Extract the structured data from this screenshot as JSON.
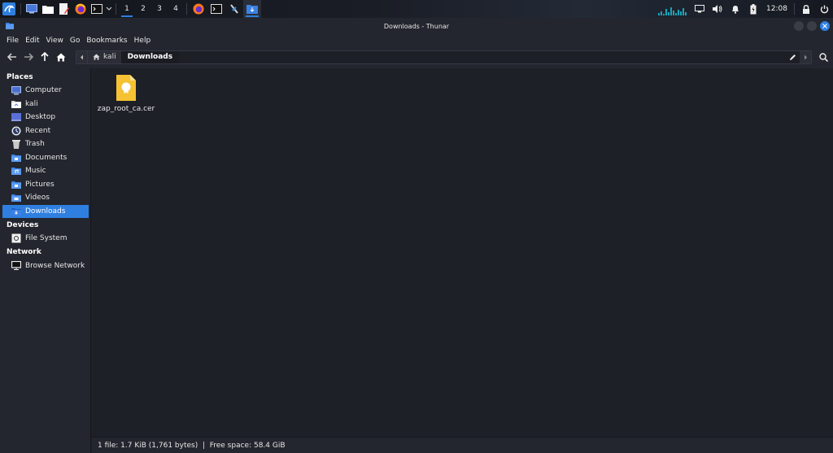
{
  "taskbar": {
    "workspaces": [
      "1",
      "2",
      "3",
      "4"
    ],
    "active_workspace": "1",
    "clock": "12:08",
    "colors": {
      "accent": "#2f7fe0",
      "graph": "#1aa3b8"
    }
  },
  "window": {
    "title": "Downloads - Thunar",
    "menu": [
      "File",
      "Edit",
      "View",
      "Go",
      "Bookmarks",
      "Help"
    ],
    "path": {
      "home": "kali",
      "current": "Downloads"
    }
  },
  "sidebar": {
    "places": {
      "header": "Places",
      "items": [
        {
          "label": "Computer",
          "icon": "computer-icon"
        },
        {
          "label": "kali",
          "icon": "home-folder-icon"
        },
        {
          "label": "Desktop",
          "icon": "desktop-icon"
        },
        {
          "label": "Recent",
          "icon": "recent-icon"
        },
        {
          "label": "Trash",
          "icon": "trash-icon"
        },
        {
          "label": "Documents",
          "icon": "documents-folder-icon"
        },
        {
          "label": "Music",
          "icon": "music-folder-icon"
        },
        {
          "label": "Pictures",
          "icon": "pictures-folder-icon"
        },
        {
          "label": "Videos",
          "icon": "videos-folder-icon"
        },
        {
          "label": "Downloads",
          "icon": "downloads-folder-icon",
          "selected": true
        }
      ]
    },
    "devices": {
      "header": "Devices",
      "items": [
        {
          "label": "File System",
          "icon": "drive-icon"
        }
      ]
    },
    "network": {
      "header": "Network",
      "items": [
        {
          "label": "Browse Network",
          "icon": "network-icon"
        }
      ]
    }
  },
  "content": {
    "files": [
      {
        "name": "zap_root_ca.cer",
        "icon": "certificate-file-icon"
      }
    ]
  },
  "status": {
    "text": "1 file: 1.7 KiB (1,761 bytes)  |  Free space: 58.4 GiB"
  }
}
